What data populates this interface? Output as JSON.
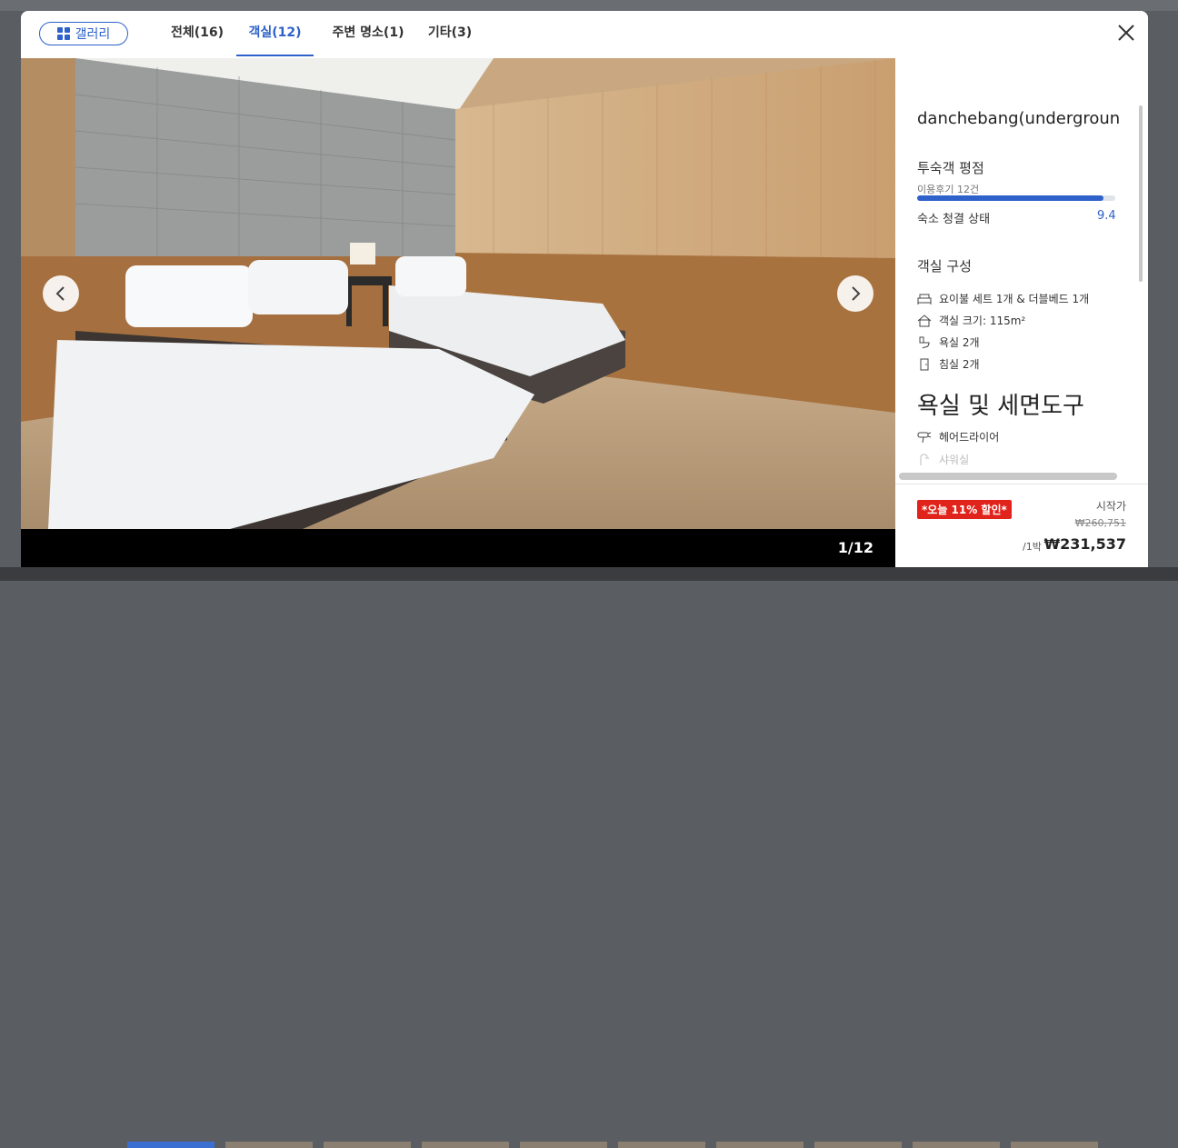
{
  "gallery": {
    "button_label": "갤러리",
    "tabs": [
      {
        "label": "전체(16)",
        "active": false
      },
      {
        "label": "객실(12)",
        "active": true
      },
      {
        "label": "주변 명소(1)",
        "active": false
      },
      {
        "label": "기타(3)",
        "active": false
      }
    ]
  },
  "photo": {
    "counter": "1/12"
  },
  "room": {
    "name": "danchebang(undergroun",
    "rating_heading": "투숙객 평점",
    "review_count": "이용후기 12건",
    "clean_label": "숙소 청결 상태",
    "clean_score": "9.4",
    "clean_fraction": 0.94,
    "config_heading": "객실 구성",
    "config": [
      {
        "icon": "bed-icon",
        "text": "요이불 세트 1개 & 더블베드 1개"
      },
      {
        "icon": "house-icon",
        "text": "객실 크기: 115m²"
      },
      {
        "icon": "toilet-icon",
        "text": "욕실 2개"
      },
      {
        "icon": "door-icon",
        "text": "침실 2개"
      }
    ],
    "bath_heading": "욕실 및 세면도구",
    "bath_items": [
      {
        "icon": "hair-dryer-icon",
        "text": "헤어드라이어"
      },
      {
        "icon": "shower-icon",
        "text": "샤워실"
      }
    ]
  },
  "price": {
    "deal_badge": "*오늘 11% 할인*",
    "start_label": "시작가",
    "old_price": "₩260,751",
    "per_night": "/1박",
    "new_price": "₩231,537"
  },
  "colors": {
    "accent": "#2e61c9",
    "deal": "#e0231b"
  }
}
